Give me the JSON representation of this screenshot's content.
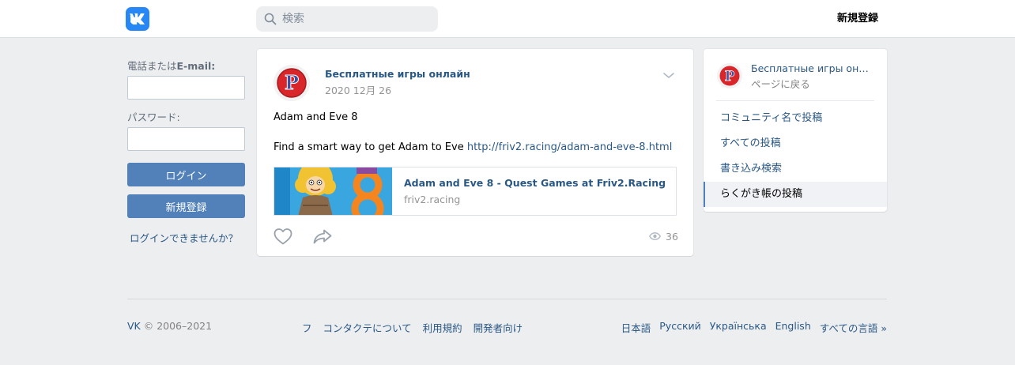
{
  "header": {
    "logo_icon": "vk-logo-icon",
    "search_placeholder": "検索",
    "register_label": "新規登録"
  },
  "login": {
    "phone_label_prefix": "電話または",
    "phone_label_bold": "E-mail:",
    "password_label": "パスワード:",
    "phone_value": "",
    "password_value": "",
    "login_button": "ログイン",
    "register_button": "新規登録",
    "forgot_link": "ログインできませんか？"
  },
  "post": {
    "author": "Бесплатные игры онлайн",
    "date": "2020 12月 26",
    "text_line1": "Adam and Eve 8",
    "text_line2_prefix": "Find a smart way to get Adam to Eve ",
    "link_url": "http://friv2.racing/adam-and-eve-8.html",
    "snippet": {
      "title": "Adam and Eve 8 - Quest Games at Friv2.Racing",
      "domain": "friv2.racing"
    },
    "views": "36",
    "accent": "#2a5885"
  },
  "sidebar": {
    "group_name": "Бесплатные игры онлайн",
    "back_label": "ページに戻る",
    "items": [
      {
        "label": "コミュニティ名で投稿"
      },
      {
        "label": "すべての投稿"
      },
      {
        "label": "書き込み検索"
      },
      {
        "label": "らくがき帳の投稿"
      }
    ]
  },
  "footer": {
    "copyright_brand": "VK",
    "copyright_rest": " © 2006–2021",
    "links": [
      "フ",
      "コンタクテについて",
      "利用規約",
      "開発者向け"
    ],
    "languages": [
      "日本語",
      "Русский",
      "Українська",
      "English",
      "すべての言語 »"
    ]
  }
}
